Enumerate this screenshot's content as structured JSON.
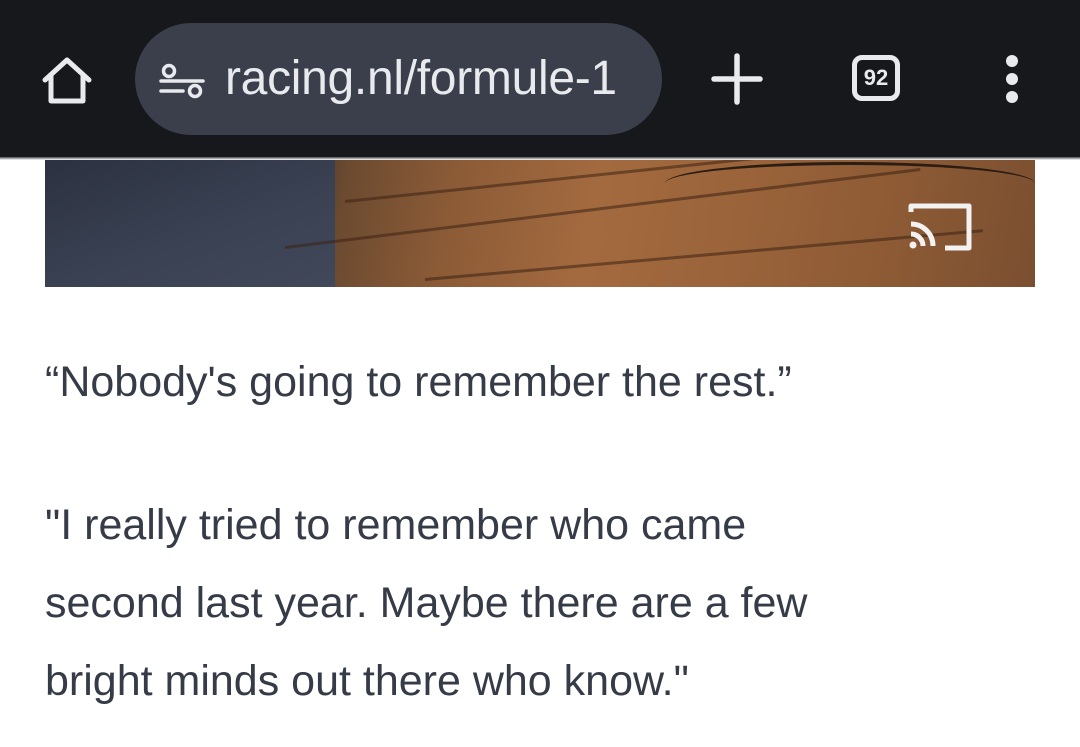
{
  "browser": {
    "url": "racing.nl/formule-1",
    "tab_count": "92",
    "icons": {
      "home": "home-icon",
      "site_info": "site-info-icon",
      "new_tab": "plus-icon",
      "menu": "more-vert-icon"
    },
    "colors": {
      "toolbar_bg": "#16181c",
      "url_pill_bg": "#3a3f4b",
      "toolbar_fg": "#e8eaed"
    }
  },
  "article": {
    "hero_image": {
      "cast_icon": "cast-icon"
    },
    "quote": "“Nobody's going to remember the rest.”",
    "paragraph_lines": [
      "\"I really tried to remember who came",
      "second last year. Maybe there are a few",
      "bright minds out there who know.\""
    ],
    "colors": {
      "text": "#363b48"
    }
  }
}
